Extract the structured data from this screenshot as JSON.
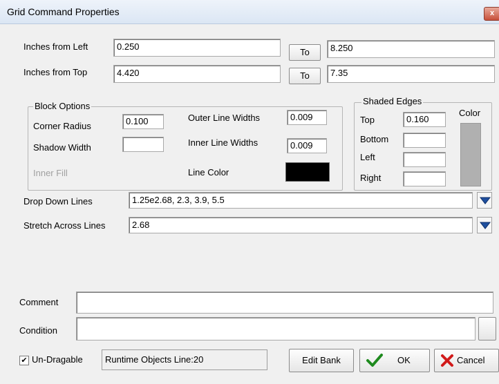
{
  "window": {
    "title": "Grid Command Properties",
    "close_glyph": "x"
  },
  "position": {
    "inches_left_label": "Inches from Left",
    "inches_left_value": "0.250",
    "inches_left_to_label": "To",
    "inches_left_to_value": "8.250",
    "inches_top_label": "Inches from Top",
    "inches_top_value": "4.420",
    "inches_top_to_label": "To",
    "inches_top_to_value": "7.35"
  },
  "block_options": {
    "legend": "Block Options",
    "corner_radius_label": "Corner Radius",
    "corner_radius_value": "0.100",
    "shadow_width_label": "Shadow Width",
    "shadow_width_value": "",
    "inner_fill_label": "Inner Fill",
    "outer_line_widths_label": "Outer Line Widths",
    "outer_line_widths_value": "0.009",
    "inner_line_widths_label": "Inner Line Widths",
    "inner_line_widths_value": "0.009",
    "line_color_label": "Line Color",
    "line_color": "#000000"
  },
  "shaded_edges": {
    "legend": "Shaded Edges",
    "top_label": "Top",
    "top_value": "0.160",
    "bottom_label": "Bottom",
    "bottom_value": "",
    "left_label": "Left",
    "left_value": "",
    "right_label": "Right",
    "right_value": "",
    "color_label": "Color",
    "color_swatch": "#b0b0b0"
  },
  "lines": {
    "drop_down_label": "Drop Down Lines",
    "drop_down_value": "1.25e2.68, 2.3, 3.9, 5.5",
    "stretch_across_label": "Stretch Across Lines",
    "stretch_across_value": "2.68"
  },
  "comment": {
    "label": "Comment",
    "value": ""
  },
  "condition": {
    "label": "Condition",
    "value": ""
  },
  "footer": {
    "undragable_label": "Un-Dragable",
    "undragable_checked": true,
    "check_glyph": "✔",
    "status_text": "Runtime Objects  Line:20",
    "edit_bank_label": "Edit Bank",
    "ok_label": "OK",
    "cancel_label": "Cancel"
  }
}
